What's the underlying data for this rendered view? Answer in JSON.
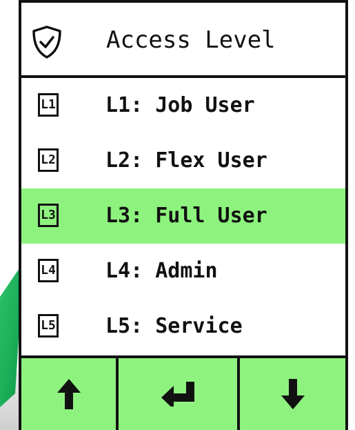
{
  "header": {
    "title": "Access Level",
    "icon": "shield-check-icon"
  },
  "levels": [
    {
      "badge": "L1",
      "label": "L1: Job User",
      "selected": false
    },
    {
      "badge": "L2",
      "label": "L2: Flex User",
      "selected": false
    },
    {
      "badge": "L3",
      "label": "L3: Full User",
      "selected": true
    },
    {
      "badge": "L4",
      "label": "L4: Admin",
      "selected": false
    },
    {
      "badge": "L5",
      "label": "L5: Service",
      "selected": false
    }
  ],
  "footer": {
    "up_icon": "arrow-up-icon",
    "enter_icon": "enter-return-icon",
    "down_icon": "arrow-down-icon"
  },
  "colors": {
    "highlight": "#8ef37e",
    "frame": "#111111",
    "background_arrow": "#1fae58"
  }
}
